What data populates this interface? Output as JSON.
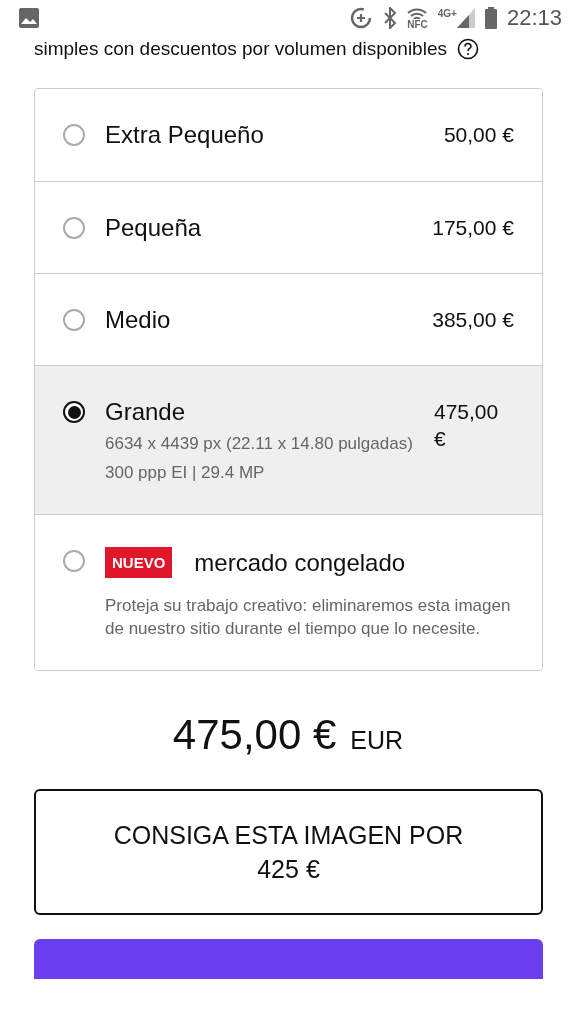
{
  "status_bar": {
    "nfc": "NFC",
    "network": "4G+",
    "time": "22:13"
  },
  "intro": "simples con descuentos por volumen disponibles",
  "options": [
    {
      "label": "Extra Pequeño",
      "price": "50,00 €",
      "selected": false
    },
    {
      "label": "Pequeña",
      "price": "175,00 €",
      "selected": false
    },
    {
      "label": "Medio",
      "price": "385,00 €",
      "selected": false
    },
    {
      "label": "Grande",
      "price": "475,00 €",
      "selected": true,
      "details": [
        "6634 x 4439 px (22.11 x 14.80 pulgadas)",
        "300 ppp EI | 29.4 MP"
      ]
    },
    {
      "label": "mercado congelado",
      "badge": "NUEVO",
      "selected": false,
      "description": "Proteja su trabajo creativo: eliminaremos esta imagen de nuestro sitio durante el tiempo que lo necesite."
    }
  ],
  "total": {
    "amount": "475,00 €",
    "currency": "EUR"
  },
  "offer_button": "CONSIGA ESTA IMAGEN POR 425 €"
}
